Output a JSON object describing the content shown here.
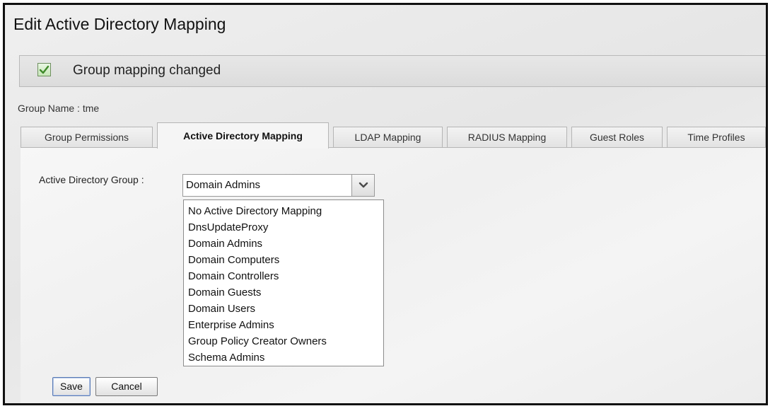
{
  "window": {
    "title": "Edit Active Directory Mapping"
  },
  "notice": {
    "icon": "checkbox-checked-icon",
    "text": "Group mapping changed"
  },
  "group": {
    "name_text": "Group Name : tme"
  },
  "tabs": [
    {
      "label": "Group Permissions",
      "active": false
    },
    {
      "label": "Active Directory Mapping",
      "active": true
    },
    {
      "label": "LDAP Mapping",
      "active": false
    },
    {
      "label": "RADIUS Mapping",
      "active": false
    },
    {
      "label": "Guest Roles",
      "active": false
    },
    {
      "label": "Time Profiles",
      "active": false
    }
  ],
  "form": {
    "ad_group_label": "Active Directory Group :",
    "ad_group_selected": "Domain Admins",
    "ad_group_options": [
      "No Active Directory Mapping",
      "DnsUpdateProxy",
      "Domain Admins",
      "Domain Computers",
      "Domain Controllers",
      "Domain Guests",
      "Domain Users",
      "Enterprise Admins",
      "Group Policy Creator Owners",
      "Schema Admins"
    ]
  },
  "buttons": {
    "save_label": "Save",
    "cancel_label": "Cancel"
  },
  "colors": {
    "accent": "#5a7bb5",
    "check": "#3f8a2a"
  }
}
